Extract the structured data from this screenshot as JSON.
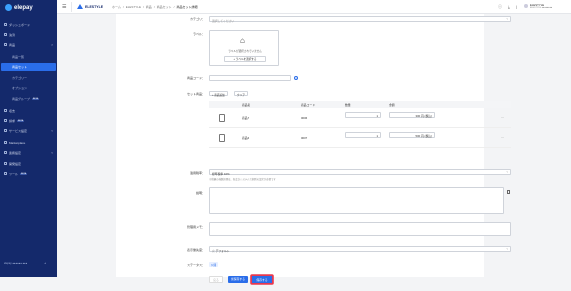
{
  "brand": {
    "name": "elepay"
  },
  "sidebar": {
    "items": [
      {
        "label": "ダッシュボード"
      },
      {
        "label": "決済"
      },
      {
        "label": "商品"
      },
      {
        "label": "収支"
      },
      {
        "label": "請求"
      },
      {
        "label": "サービス設定"
      },
      {
        "label": "Marketplace"
      },
      {
        "label": "連携設定"
      },
      {
        "label": "開発設定"
      },
      {
        "label": "ツール"
      }
    ],
    "sub_items": [
      {
        "label": "商品一覧"
      },
      {
        "label": "商品セット"
      },
      {
        "label": "カテゴリー"
      },
      {
        "label": "オプション"
      },
      {
        "label": "商品グループ"
      }
    ],
    "badge_beta": "BETA",
    "footer_left": "elepay ●●●●●● ●●●",
    "footer_right": "⇥"
  },
  "topbar": {
    "menu_icon": "☰",
    "brand": "ELESTYLE",
    "breadcrumb": [
      "ホーム",
      "ELESTYLE",
      "商品",
      "商品セット",
      "商品セット詳細"
    ],
    "user_name": "ELESTYLE",
    "user_sub": "ELESTYLE ●●●●●●●●"
  },
  "form": {
    "category_label": "カテゴリ：",
    "category_placeholder": "選択してください",
    "label_label": "ラベル：",
    "label_empty": "ラベルが選択されていません",
    "label_button": "ラベルを選択する",
    "code_label": "商品コード：",
    "set_label": "セット商品：",
    "add_button": "商品追加",
    "clear_button": "クリア",
    "table_headers": [
      "商品名",
      "商品コード",
      "数量",
      "金額"
    ],
    "rows": [
      {
        "name": "商品7",
        "code": "0006",
        "qty": "1",
        "amount": "300",
        "unit": "円 (税込)"
      },
      {
        "name": "商品6",
        "code": "0007",
        "qty": "1",
        "amount": "500",
        "unit": "円 (税込)"
      }
    ],
    "tax_label": "適用税率：",
    "tax_value": "標準税率 10%",
    "tax_hint": "※税額の端数処理は、各会計システムで個別の設定が必要です",
    "desc_label": "説明：",
    "memo_label": "管理用メモ：",
    "display_label": "表示優先度：",
    "display_value": "デフォルト",
    "status_label": "ステータス：",
    "status_value": "公開",
    "cancel_button": "戻る",
    "save_button": "仮保存する",
    "publish_button": "保存する"
  },
  "colors": {
    "sidebar_bg": "#14296b",
    "accent": "#2a6de9",
    "highlight": "#e8384f"
  }
}
